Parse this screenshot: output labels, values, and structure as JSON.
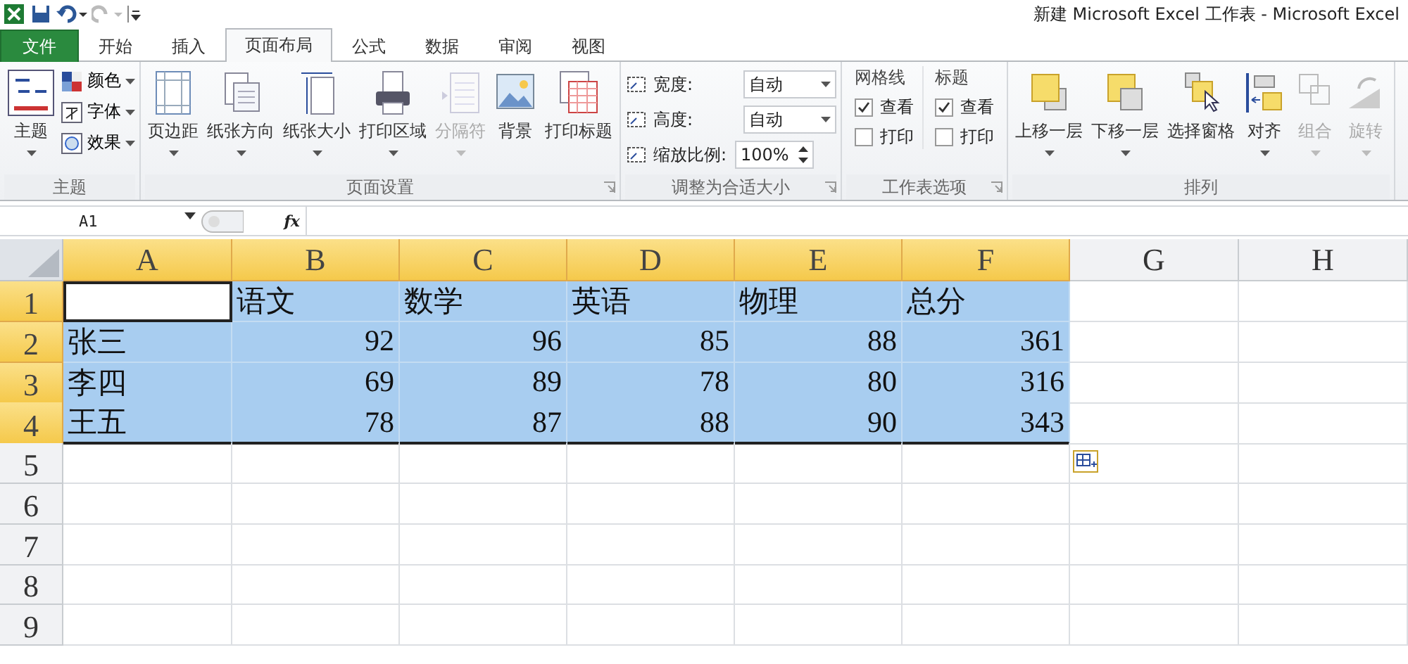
{
  "window": {
    "title": "新建 Microsoft Excel 工作表 - Microsoft Excel"
  },
  "tabs": [
    {
      "label": "文件",
      "kind": "file",
      "selected": false
    },
    {
      "label": "开始",
      "kind": "tab",
      "selected": false
    },
    {
      "label": "插入",
      "kind": "tab",
      "selected": false
    },
    {
      "label": "页面布局",
      "kind": "tab",
      "selected": true
    },
    {
      "label": "公式",
      "kind": "tab",
      "selected": false
    },
    {
      "label": "数据",
      "kind": "tab",
      "selected": false
    },
    {
      "label": "审阅",
      "kind": "tab",
      "selected": false
    },
    {
      "label": "视图",
      "kind": "tab",
      "selected": false
    }
  ],
  "ribbon": {
    "groups": [
      {
        "label": "主题",
        "kind": "theme",
        "launcher": false,
        "big": [
          {
            "label": "主题",
            "caret": true,
            "disabled": false
          }
        ],
        "small": [
          {
            "label": "颜色"
          },
          {
            "label": "字体"
          },
          {
            "label": "效果"
          }
        ]
      },
      {
        "label": "页面设置",
        "kind": "buttons",
        "launcher": true,
        "big": [
          {
            "label": "页边距",
            "caret": true,
            "disabled": false
          },
          {
            "label": "纸张方向",
            "caret": true,
            "disabled": false
          },
          {
            "label": "纸张大小",
            "caret": true,
            "disabled": false
          },
          {
            "label": "打印区域",
            "caret": true,
            "disabled": false
          },
          {
            "label": "分隔符",
            "caret": true,
            "disabled": true
          },
          {
            "label": "背景",
            "caret": false,
            "disabled": false
          },
          {
            "label": "打印标题",
            "caret": false,
            "disabled": false
          }
        ]
      },
      {
        "label": "调整为合适大小",
        "kind": "scale",
        "launcher": true,
        "fields": [
          {
            "label": "宽度:",
            "value": "自动",
            "kind": "dropdown"
          },
          {
            "label": "高度:",
            "value": "自动",
            "kind": "dropdown"
          },
          {
            "label": "缩放比例:",
            "value": "100%",
            "kind": "spinner"
          }
        ]
      },
      {
        "label": "工作表选项",
        "kind": "options",
        "launcher": true,
        "columns": [
          {
            "label": "网格线",
            "options": [
              {
                "label": "查看",
                "checked": true
              },
              {
                "label": "打印",
                "checked": false
              }
            ]
          },
          {
            "label": "标题",
            "options": [
              {
                "label": "查看",
                "checked": true
              },
              {
                "label": "打印",
                "checked": false
              }
            ]
          }
        ]
      },
      {
        "label": "排列",
        "kind": "buttons",
        "launcher": false,
        "big": [
          {
            "label": "上移一层",
            "caret": true,
            "disabled": false
          },
          {
            "label": "下移一层",
            "caret": true,
            "disabled": false
          },
          {
            "label": "选择窗格",
            "caret": false,
            "disabled": false
          },
          {
            "label": "对齐",
            "caret": true,
            "disabled": false
          },
          {
            "label": "组合",
            "caret": true,
            "disabled": true
          },
          {
            "label": "旋转",
            "caret": true,
            "disabled": true
          }
        ]
      }
    ]
  },
  "formula_bar": {
    "name_box": "A1",
    "fx": "fx"
  },
  "sheet": {
    "columns": [
      {
        "label": "A",
        "selected": true
      },
      {
        "label": "B",
        "selected": true
      },
      {
        "label": "C",
        "selected": true
      },
      {
        "label": "D",
        "selected": true
      },
      {
        "label": "E",
        "selected": true
      },
      {
        "label": "F",
        "selected": true
      },
      {
        "label": "G",
        "selected": false
      },
      {
        "label": "H",
        "selected": false
      }
    ],
    "rows": [
      {
        "header": "1",
        "selected": true,
        "cells": [
          {
            "kind": "empty",
            "active": true
          },
          {
            "text": "语文",
            "kind": "text",
            "selected": true,
            "active": false
          },
          {
            "text": "数学",
            "kind": "text",
            "selected": true,
            "active": false
          },
          {
            "text": "英语",
            "kind": "text",
            "selected": true,
            "active": false
          },
          {
            "text": "物理",
            "kind": "text",
            "selected": true,
            "active": false
          },
          {
            "text": "总分",
            "kind": "text",
            "selected": true,
            "active": false
          }
        ]
      },
      {
        "header": "2",
        "selected": true,
        "cells": [
          {
            "text": "张三",
            "kind": "text",
            "selected": true,
            "active": false
          },
          {
            "text": "92",
            "kind": "number",
            "selected": true,
            "active": false
          },
          {
            "text": "96",
            "kind": "number",
            "selected": true,
            "active": false
          },
          {
            "text": "85",
            "kind": "number",
            "selected": true,
            "active": false
          },
          {
            "text": "88",
            "kind": "number",
            "selected": true,
            "active": false
          },
          {
            "text": "361",
            "kind": "number",
            "selected": true,
            "active": false
          }
        ]
      },
      {
        "header": "3",
        "selected": true,
        "cells": [
          {
            "text": "李四",
            "kind": "text",
            "selected": true,
            "active": false
          },
          {
            "text": "69",
            "kind": "number",
            "selected": true,
            "active": false
          },
          {
            "text": "89",
            "kind": "number",
            "selected": true,
            "active": false
          },
          {
            "text": "78",
            "kind": "number",
            "selected": true,
            "active": false
          },
          {
            "text": "80",
            "kind": "number",
            "selected": true,
            "active": false
          },
          {
            "text": "316",
            "kind": "number",
            "selected": true,
            "active": false
          }
        ]
      },
      {
        "header": "4",
        "selected": true,
        "cells": [
          {
            "text": "王五",
            "kind": "text",
            "selected": true,
            "active": false
          },
          {
            "text": "78",
            "kind": "number",
            "selected": true,
            "active": false
          },
          {
            "text": "87",
            "kind": "number",
            "selected": true,
            "active": false
          },
          {
            "text": "88",
            "kind": "number",
            "selected": true,
            "active": false
          },
          {
            "text": "90",
            "kind": "number",
            "selected": true,
            "active": false
          },
          {
            "text": "343",
            "kind": "number",
            "selected": true,
            "active": false
          }
        ]
      },
      {
        "header": "5",
        "selected": false
      },
      {
        "header": "6",
        "selected": false
      },
      {
        "header": "7",
        "selected": false
      },
      {
        "header": "8",
        "selected": false
      },
      {
        "header": "9",
        "selected": false
      }
    ]
  }
}
